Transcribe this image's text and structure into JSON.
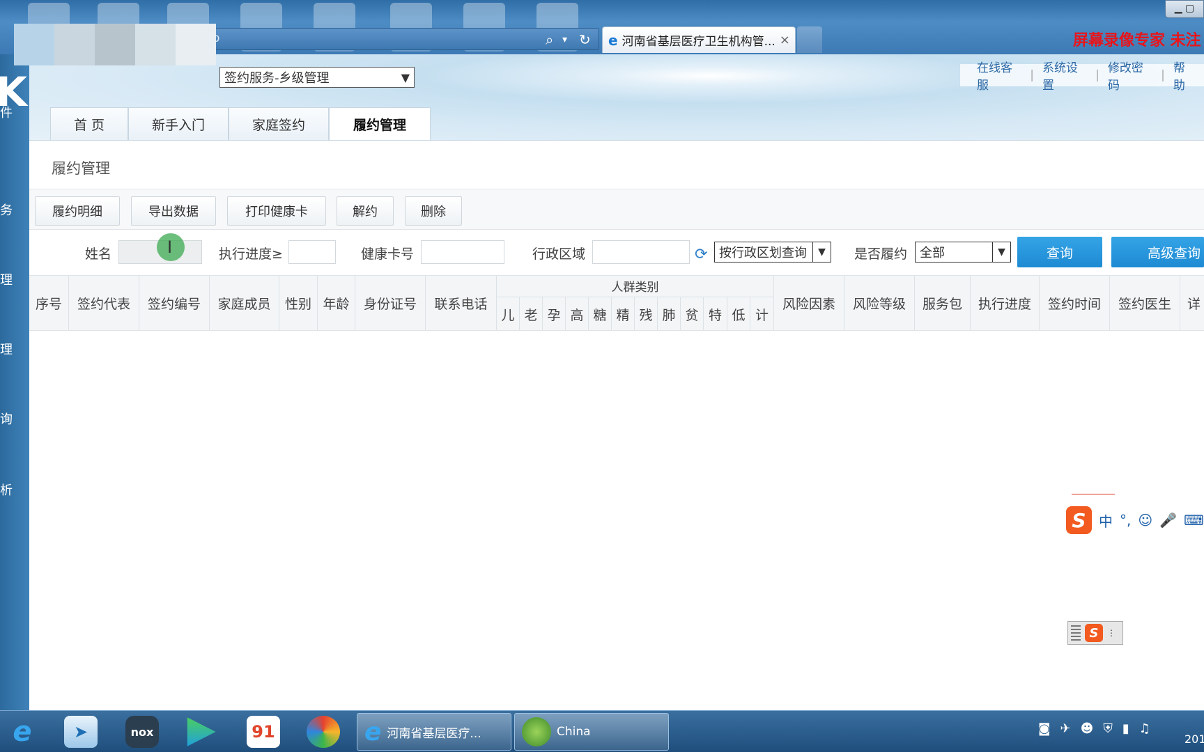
{
  "browser": {
    "tab_title": "河南省基层医疗卫生机构管...",
    "tab_close": "×",
    "recorder_watermark": "屏幕录像专家 未注",
    "address_partial": "o"
  },
  "rail": {
    "items": [
      "件",
      "务",
      "理",
      "理",
      "询",
      "析"
    ]
  },
  "header": {
    "system_select": "签约服务-乡级管理",
    "links": [
      "在线客服",
      "系统设置",
      "修改密码",
      "帮助"
    ]
  },
  "nav": {
    "tabs": [
      {
        "label": "首 页",
        "active": false
      },
      {
        "label": "新手入门",
        "active": false
      },
      {
        "label": "家庭签约",
        "active": false
      },
      {
        "label": "履约管理",
        "active": true
      }
    ]
  },
  "page": {
    "title": "履约管理"
  },
  "actions": [
    "履约明细",
    "导出数据",
    "打印健康卡",
    "解约",
    "删除"
  ],
  "filters": {
    "name_label": "姓名",
    "name_value": "",
    "progress_label": "执行进度≥",
    "progress_value": "",
    "card_label": "健康卡号",
    "card_value": "",
    "region_label": "行政区域",
    "region_value": "",
    "region_mode": "按行政区划查询",
    "fulfilled_label": "是否履约",
    "fulfilled_value": "全部",
    "query_button": "查询",
    "advanced_button": "高级查询"
  },
  "table": {
    "columns_left": [
      "序号",
      "签约代表",
      "签约编号",
      "家庭成员",
      "性别",
      "年龄",
      "身份证号",
      "联系电话"
    ],
    "group_label": "人群类别",
    "group_subs": [
      "儿",
      "老",
      "孕",
      "高",
      "糖",
      "精",
      "残",
      "肺",
      "贫",
      "特",
      "低",
      "计"
    ],
    "columns_right": [
      "风险因素",
      "风险等级",
      "服务包",
      "执行进度",
      "签约时间",
      "签约医生",
      "详"
    ],
    "rows": []
  },
  "ime": {
    "mode": "中",
    "punct": "°,"
  },
  "taskbar": {
    "windows": [
      "河南省基层医疗...",
      "China"
    ],
    "clock": "201"
  }
}
